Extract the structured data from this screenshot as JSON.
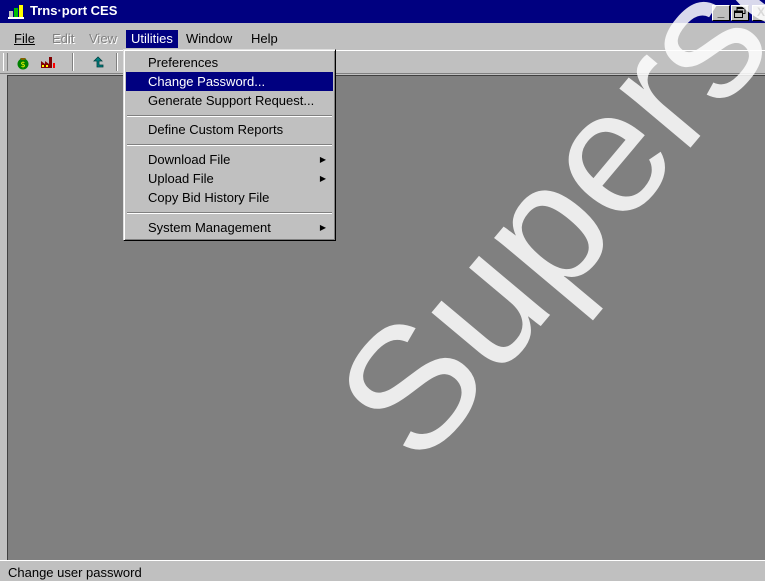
{
  "window": {
    "title": "Trns·port CES",
    "minimize_label": "_",
    "restore_label": "🗗",
    "close_label": "X"
  },
  "menubar": [
    {
      "label": "File",
      "disabled": false
    },
    {
      "label": "Edit",
      "disabled": true
    },
    {
      "label": "View",
      "disabled": true
    },
    {
      "label": "Utilities",
      "disabled": false,
      "open": true
    },
    {
      "label": "Window",
      "disabled": false
    },
    {
      "label": "Help",
      "disabled": false
    }
  ],
  "utilities_menu": [
    {
      "label": "Preferences",
      "selected": false,
      "submenu": false
    },
    {
      "label": "Change Password...",
      "selected": true,
      "submenu": false
    },
    {
      "label": "Generate Support Request...",
      "selected": false,
      "submenu": false
    },
    {
      "label": "Define Custom Reports",
      "selected": false,
      "submenu": false
    },
    {
      "label": "Download File",
      "selected": false,
      "submenu": true
    },
    {
      "label": "Upload File",
      "selected": false,
      "submenu": true
    },
    {
      "label": "Copy Bid History File",
      "selected": false,
      "submenu": false
    },
    {
      "label": "System Management",
      "selected": false,
      "submenu": true
    }
  ],
  "toolbar": {
    "icons": [
      "money-bag-icon",
      "factory-icon",
      "back-arrow-icon"
    ],
    "submenu_glyph": "▶"
  },
  "statusbar": {
    "text": "Change user password"
  },
  "watermark": {
    "text": "Superseded",
    "color": "#ffffff"
  },
  "colors": {
    "titlebar": "#000080",
    "face": "#c0c0c0",
    "client": "#808080",
    "highlight": "#000080"
  }
}
